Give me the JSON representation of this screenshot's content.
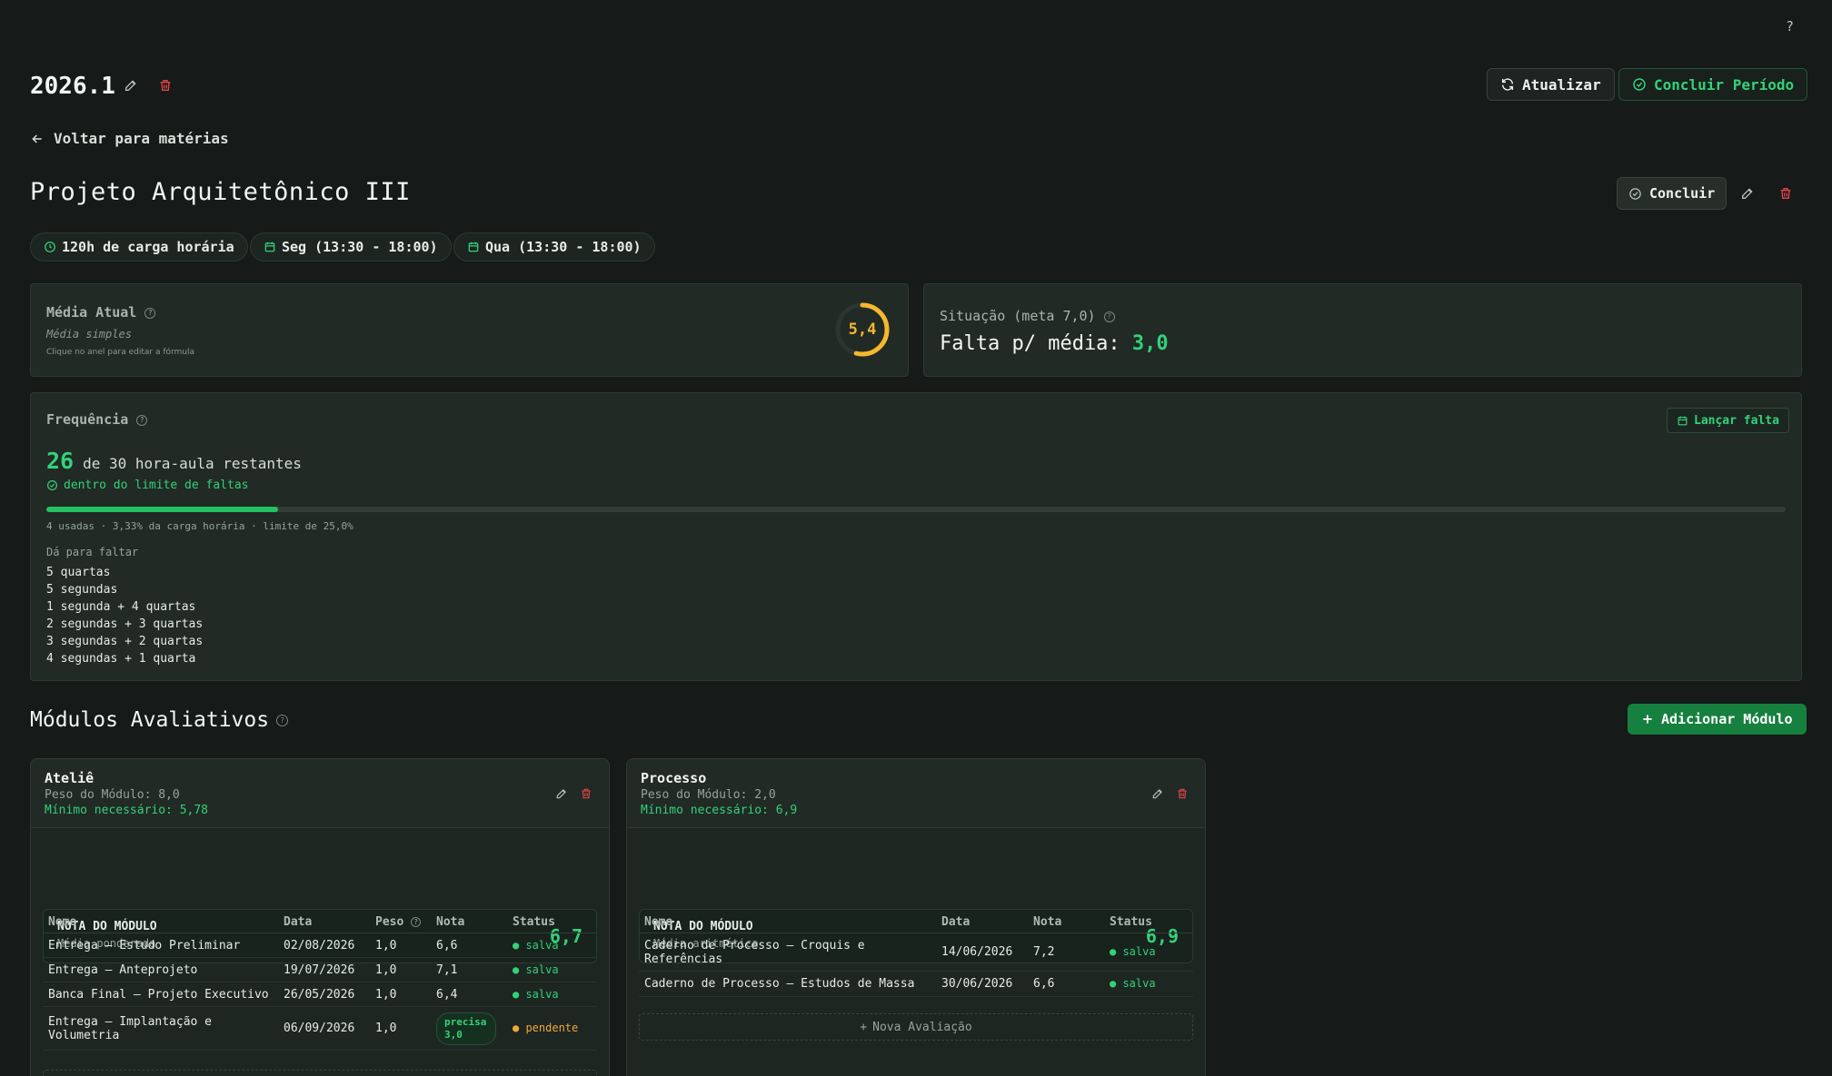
{
  "help": "?",
  "period": {
    "title": "2026.1"
  },
  "actions": {
    "refresh": "Atualizar",
    "conclude_period": "Concluir Período"
  },
  "back_link": "Voltar para matérias",
  "subject": {
    "title": "Projeto Arquitetônico III",
    "conclude": "Concluir",
    "chips": [
      "120h de carga horária",
      "Seg (13:30 - 18:00)",
      "Qua (13:30 - 18:00)"
    ]
  },
  "average": {
    "label": "Média Atual",
    "formula": "Média simples",
    "hint": "Clique no anel para editar a fórmula",
    "value": "5,4",
    "ring_fraction": 0.54,
    "ring_color": "#f5b82e"
  },
  "situation": {
    "label": "Situação (meta 7,0)",
    "text": "Falta p/ média: ",
    "value": "3,0"
  },
  "frequency": {
    "label": "Frequência",
    "add_absence": "Lançar falta",
    "remaining": "26",
    "remaining_text": "de 30 hora-aula restantes",
    "status": "dentro do limite de faltas",
    "used_fraction": 0.1333,
    "details": "4 usadas · 3,33% da carga horária · limite de 25,0%",
    "can_miss_label": "Dá para faltar",
    "can_miss": [
      "5 quartas",
      "5 segundas",
      "1 segunda + 4 quartas",
      "2 segundas + 3 quartas",
      "3 segundas + 2 quartas",
      "4 segundas + 1 quarta"
    ]
  },
  "modules_section": {
    "title": "Módulos Avaliativos",
    "add_module": "Adicionar Módulo"
  },
  "modules": [
    {
      "name": "Ateliê",
      "weight": "Peso do Módulo: 8,0",
      "minimum": "Mínimo necessário: 5,78",
      "note_label": "NOTA DO MÓDULO",
      "note_method": "Média ponderada",
      "note_value": "6,7",
      "columns": [
        "Nome",
        "Data",
        "Peso",
        "Nota",
        "Status"
      ],
      "rows": [
        {
          "name": "Entrega — Estudo Preliminar",
          "date": "02/08/2026",
          "weight": "1,0",
          "grade": "6,6",
          "status": "salva"
        },
        {
          "name": "Entrega — Anteprojeto",
          "date": "19/07/2026",
          "weight": "1,0",
          "grade": "7,1",
          "status": "salva"
        },
        {
          "name": "Banca Final — Projeto Executivo",
          "date": "26/05/2026",
          "weight": "1,0",
          "grade": "6,4",
          "status": "salva"
        },
        {
          "name": "Entrega — Implantação e Volumetria",
          "date": "06/09/2026",
          "weight": "1,0",
          "grade": "precisa 3,0",
          "status": "pendente"
        }
      ]
    },
    {
      "name": "Processo",
      "weight": "Peso do Módulo: 2,0",
      "minimum": "Mínimo necessário: 6,9",
      "note_label": "NOTA DO MÓDULO",
      "note_method": "Média aritmética",
      "note_value": "6,9",
      "columns": [
        "Nome",
        "Data",
        "Nota",
        "Status"
      ],
      "rows": [
        {
          "name": "Caderno de Processo — Croquis e Referências",
          "date": "14/06/2026",
          "grade": "7,2",
          "status": "salva"
        },
        {
          "name": "Caderno de Processo — Estudos de Massa",
          "date": "30/06/2026",
          "grade": "6,6",
          "status": "salva"
        }
      ],
      "new_evaluation": "Nova Avaliação"
    }
  ],
  "colors": {
    "accent": "#34d17a",
    "danger": "#e0454a",
    "warning": "#f5b82e",
    "background": "#161a18"
  }
}
